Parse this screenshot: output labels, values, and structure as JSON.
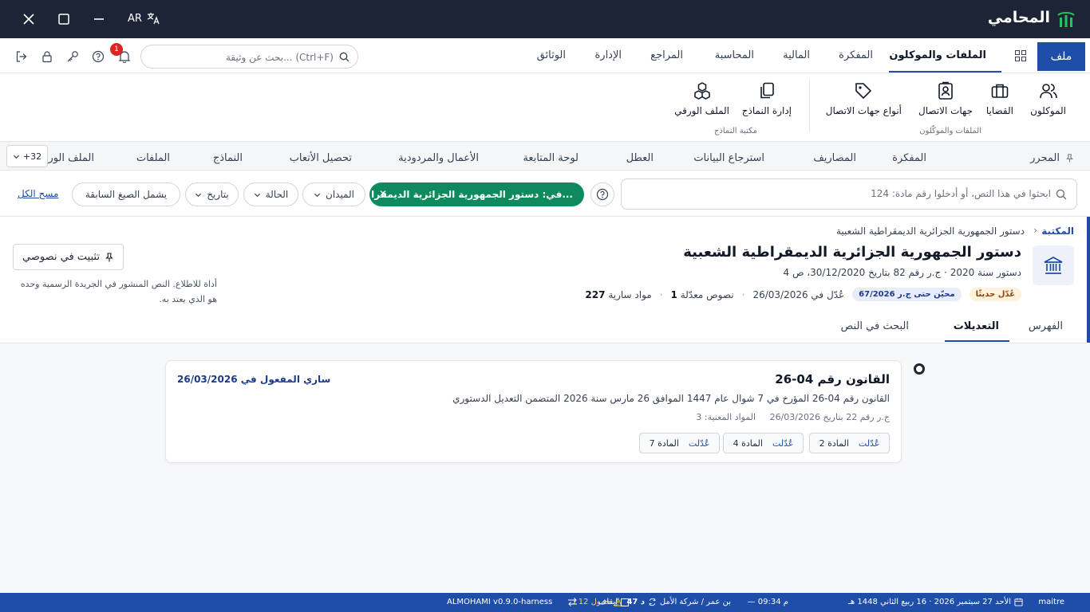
{
  "window": {
    "app_title": "المحامي",
    "lang": "AR"
  },
  "menu": {
    "file_label": "ملف",
    "items": [
      "الملفات والموكلون",
      "المفكرة",
      "المالية",
      "المحاسبة",
      "المراجع",
      "الإدارة",
      "الوثائق"
    ],
    "active": "الملفات والموكلون"
  },
  "search": {
    "placeholder": "بحث عن وثيقة... (Ctrl+F)"
  },
  "notifications": {
    "count": "1"
  },
  "ribbon": {
    "group1": {
      "label": "الملفات والموكّلون",
      "buttons": [
        "الموكلون",
        "القضايا",
        "جهات الاتصال",
        "أنواع جهات الاتصال"
      ]
    },
    "group2": {
      "label": "مكتبة النماذج",
      "buttons": [
        "إدارة النماذج",
        "الملف الورقي"
      ]
    }
  },
  "module_tabs": {
    "items": [
      "المحرر",
      "المفكرة",
      "المصاريف",
      "استرجاع البيانات",
      "العطل",
      "لوحة المتابعة",
      "الأعمال والمردودية",
      "تحصيل الأتعاب",
      "النماذج",
      "الملفات",
      "الملف الور"
    ],
    "more_label": "+32"
  },
  "filter": {
    "search_placeholder": "ابحثوا في هذا النص، أو أدخلوا رقم مادة: 124",
    "scope_chip": "في: دستور الجمهورية الجزائرية الديمقرا...",
    "chips": [
      "الميدان",
      "الحالة",
      "بتاريخ",
      "يشمل الصيغ السابقة"
    ],
    "clear_all": "مسح الكل"
  },
  "breadcrumb": {
    "root": "المكتبة",
    "current": "دستور الجمهورية الجزائرية الديمقراطية الشعبية"
  },
  "document": {
    "title": "دستور الجمهورية الجزائرية الديمقراطية الشعبية",
    "meta": "دستور سنة 2020 · ج.ر رقم 82 بتاريخ 30/12/2020، ص 4",
    "stats": {
      "articles_count": "227",
      "articles_label": "مواد سارية",
      "amended_count": "1",
      "amended_label": "نصوص معدّلة",
      "amended_on": "عُدّل في 26/03/2026",
      "updated_badge": "محيّن حتى ج.ر 67/2026",
      "recent_badge": "عُدّل حديثًا"
    },
    "pin_label": "تثبيت في نصوصي",
    "disclaimer": "أداة للاطلاع. النص المنشور في الجريدة الرسمية وحده هو الذي يعتد به."
  },
  "doc_tabs": {
    "items": [
      "الفهرس",
      "التعديلات",
      "البحث في النص"
    ],
    "active": "التعديلات"
  },
  "amendment": {
    "title": "القانون رقم 04-26",
    "status": "ساري المفعول في 26/03/2026",
    "description": "القانون رقم 04-26 المؤرخ في 7 شوال عام 1447 الموافق 26 مارس سنة 2026 المتضمن التعديل الدستوري",
    "reference": "ج.ر رقم 22 بتاريخ 26/03/2026",
    "affected": "المواد المعنية: 3",
    "articles": [
      {
        "label": "المادة 2",
        "tag": "عُدّلت"
      },
      {
        "label": "المادة 4",
        "tag": "عُدّلت"
      },
      {
        "label": "المادة 7",
        "tag": "عُدّلت"
      }
    ]
  },
  "statusbar": {
    "user": "maitre",
    "date": "الأحد 27 سبتمبر 2026 · 16 ربيع الثاني 1448 هـ",
    "time": "— 09:34 م",
    "sessions": "47 د",
    "office": "بن عمر / شركة الأمل",
    "warning": "خمول 12 د",
    "pause": "إيقاف",
    "version": "ALMOHAMI v0.9.0-harness"
  }
}
